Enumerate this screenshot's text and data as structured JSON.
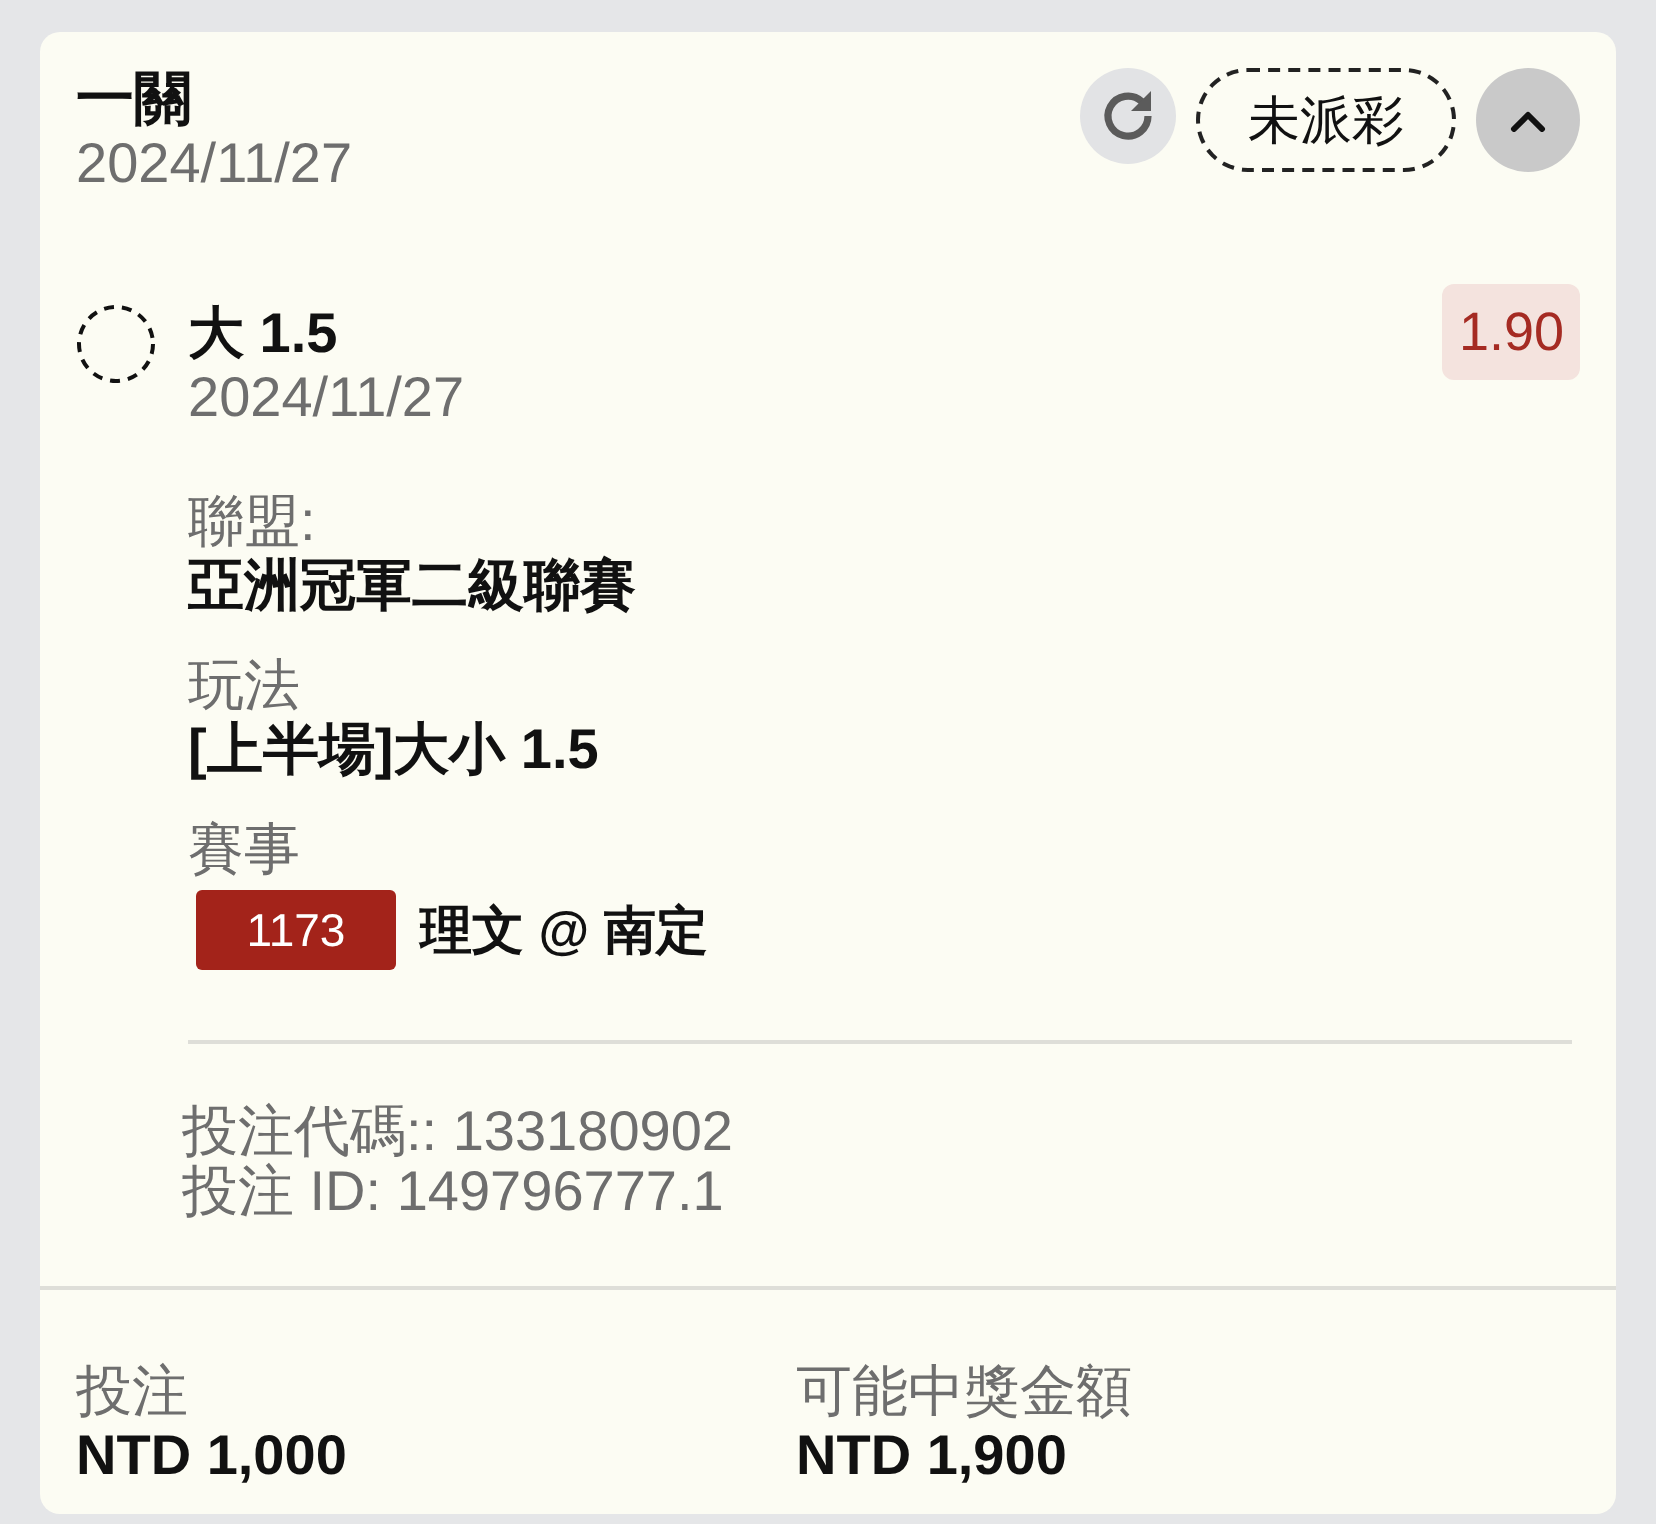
{
  "header": {
    "title": "一關",
    "date": "2024/11/27",
    "status": "未派彩",
    "expanded": true
  },
  "selection": {
    "name": "大 1.5",
    "date": "2024/11/27",
    "odds": "1.90"
  },
  "fields": [
    {
      "kind": "text",
      "label": "聯盟:",
      "value": "亞洲冠軍二級聯賽"
    },
    {
      "kind": "text",
      "label": "玩法",
      "value": "[上半場]大小 1.5"
    },
    {
      "kind": "match",
      "label": "賽事",
      "match_number": "1173",
      "value": "理文 @ 南定"
    }
  ],
  "references": [
    "投注代碼:: 133180902",
    "投注 ID: 149796777.1"
  ],
  "summary": [
    {
      "label": "投注",
      "value": "NTD 1,000"
    },
    {
      "label": "可能中獎金額",
      "value": "NTD 1,900"
    }
  ]
}
